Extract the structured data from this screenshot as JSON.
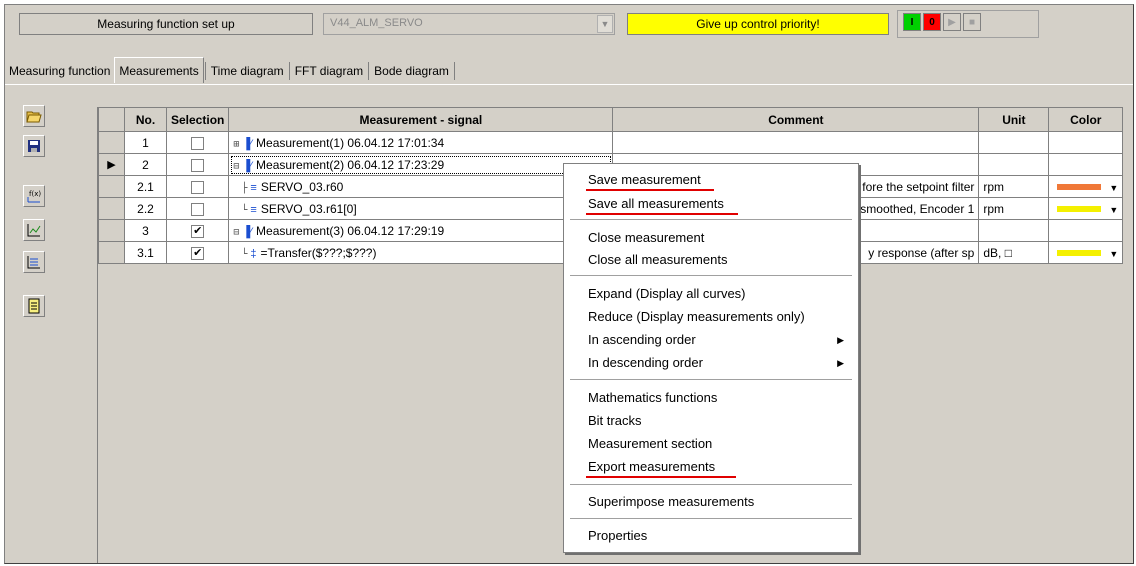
{
  "toolbar": {
    "function_setup": "Measuring function set up",
    "combo_value": "V44_ALM_SERVO",
    "give_up": "Give up control priority!",
    "green_btn": "I",
    "red_btn": "0"
  },
  "tabs": [
    {
      "label": "Measuring function"
    },
    {
      "label": "Measurements"
    },
    {
      "label": "Time diagram"
    },
    {
      "label": "FFT diagram"
    },
    {
      "label": "Bode diagram"
    }
  ],
  "table": {
    "headers": {
      "no": "No.",
      "selection": "Selection",
      "signal": "Measurement - signal",
      "comment": "Comment",
      "unit": "Unit",
      "color": "Color"
    },
    "rows": [
      {
        "no": "1",
        "signal": "Measurement(1)  06.04.12 17:01:34",
        "comment": "",
        "unit": "",
        "checked": false,
        "color": ""
      },
      {
        "no": "2",
        "signal": "Measurement(2)  06.04.12 17:23:29",
        "comment": "",
        "unit": "",
        "checked": false,
        "color": ""
      },
      {
        "no": "2.1",
        "signal": "SERVO_03.r60",
        "comment": "fore the setpoint filter",
        "unit": "rpm",
        "checked": false,
        "color": "#f07838"
      },
      {
        "no": "2.2",
        "signal": "SERVO_03.r61[0]",
        "comment": "nsmoothed, Encoder 1",
        "unit": "rpm",
        "checked": false,
        "color": "#f4f000"
      },
      {
        "no": "3",
        "signal": "Measurement(3)  06.04.12 17:29:19",
        "comment": "",
        "unit": "",
        "checked": true,
        "color": ""
      },
      {
        "no": "3.1",
        "signal": "=Transfer($???;$???)",
        "comment": "y response (after sp",
        "unit": "dB, □",
        "checked": true,
        "color": "#f4f000"
      }
    ]
  },
  "menu": {
    "items": [
      "Save measurement",
      "Save all measurements",
      "Close measurement",
      "Close all measurements",
      "Expand (Display all curves)",
      "Reduce (Display measurements only)",
      "In ascending order",
      "In descending order",
      "Mathematics functions",
      "Bit tracks",
      "Measurement section",
      "Export measurements",
      "Superimpose measurements",
      "Properties"
    ]
  },
  "colors": {
    "highlight_yellow": "#ffff00",
    "underline_red": "#e00000",
    "face": "#d4d0c8"
  }
}
